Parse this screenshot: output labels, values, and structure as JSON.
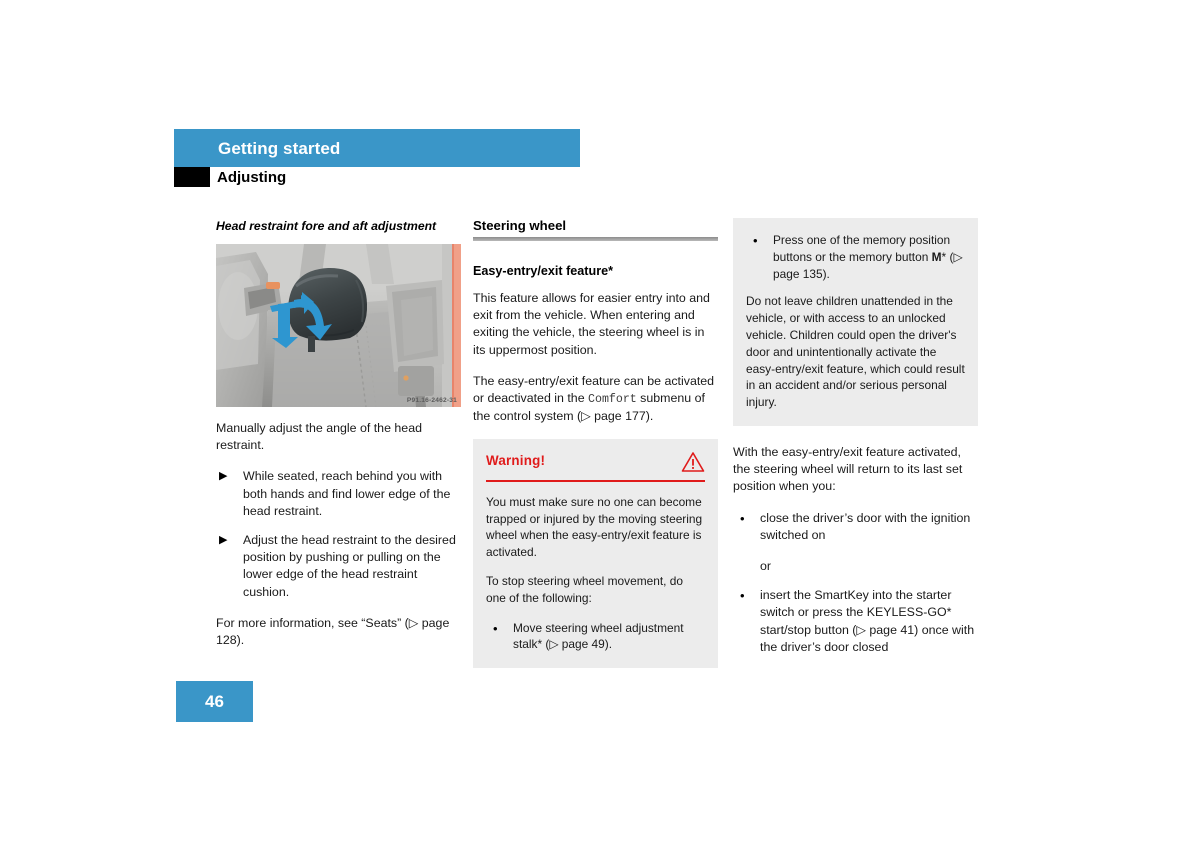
{
  "header": {
    "band_title": "Getting started",
    "section_title": "Adjusting",
    "band_color": "#3a96c8",
    "tab_color": "#000000"
  },
  "left_column": {
    "heading": "Head restraint fore and aft adjustment",
    "figure": {
      "alt": "Rear seat head restraint with blue adjustment arrows",
      "code": "P91.16-2462-31"
    },
    "intro": "Manually adjust the angle of the head restraint.",
    "steps": [
      {
        "marker": "▶",
        "text": "While seated, reach behind you with both hands and find lower edge of the head restraint."
      },
      {
        "marker": "▶",
        "text": "Adjust the head restraint to the desired position by pushing or pulling on the lower edge of the head restraint cushion."
      }
    ],
    "more_info": "For more information, see “Seats” (▷ page 128)."
  },
  "middle_column": {
    "heading": "Steering wheel",
    "subheading": "Easy-entry/exit feature*",
    "paragraph_1": "This feature allows for easier entry into and exit from the vehicle. When entering and exiting the vehicle, the steering wheel is in its uppermost position.",
    "paragraph_2_before": "The easy-entry/exit feature can be activated or deactivated in the ",
    "paragraph_2_mono": "Comfort",
    "paragraph_2_after": " submenu of the control system (▷ page 177).",
    "warning": {
      "title": "Warning!",
      "icon": "warning-triangle-icon",
      "accent_color": "#e01b1b",
      "background_color": "#ececec",
      "body_1": "You must make sure no one can become trapped or injured by the moving steering wheel when the easy-entry/exit feature is activated.",
      "body_2": "To stop steering wheel movement, do one of the following:",
      "bullets": [
        {
          "marker": "•",
          "text": "Move steering wheel adjustment stalk* (▷ page 49)."
        }
      ]
    }
  },
  "right_column": {
    "note": {
      "background_color": "#ececec",
      "bullets": [
        {
          "marker": "•",
          "text_before": "Press one of the memory position buttons or the memory button ",
          "bold_text": "M",
          "text_after": "* (▷ page 135)."
        }
      ],
      "body": "Do not leave children unattended in the vehicle, or with access to an unlocked vehicle. Children could open the driver's door and unintentionally activate the easy-entry/exit feature, which could result in an accident and/or serious personal injury."
    },
    "paragraph": "With the easy-entry/exit feature activated, the steering wheel will return to its last set position when you:",
    "bullets": [
      {
        "marker": "•",
        "text": "close the driver’s door with the ignition switched on"
      }
    ],
    "or_text": "or",
    "bullets_2": [
      {
        "marker": "•",
        "text": "insert the SmartKey into the starter switch or press the KEYLESS-GO* start/stop button (▷ page 41) once with the driver’s door closed"
      }
    ]
  },
  "footer": {
    "page_number": "46",
    "box_color": "#3a96c8"
  }
}
